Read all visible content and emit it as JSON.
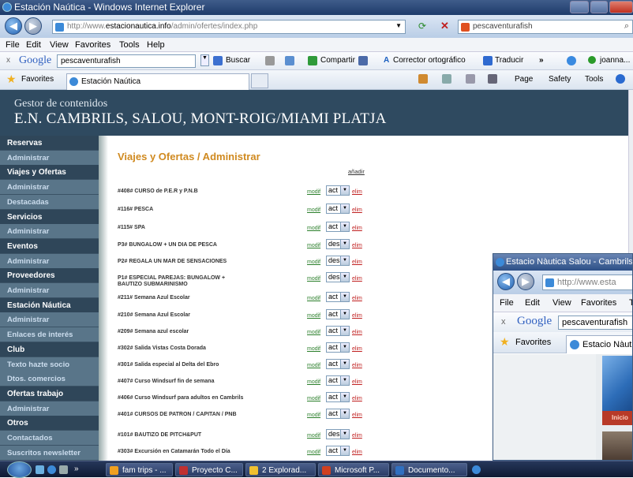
{
  "browser": {
    "title": "Estación Naútica - Windows Internet Explorer",
    "url_prefix": "http://www.",
    "url_domain": "estacionautica.info",
    "url_path": "/admin/ofertes/index.php",
    "search_value": "pescaventurafish",
    "menu": [
      "File",
      "Edit",
      "View",
      "Favorites",
      "Tools",
      "Help"
    ],
    "google_label": "Google",
    "google_search": "pescaventurafish",
    "toolbar": {
      "buscar": "Buscar",
      "compartir": "Compartir",
      "corrector": "Corrector ortográfico",
      "traducir": "Traducir",
      "more": "»",
      "user": "joanna..."
    },
    "favorites_label": "Favorites",
    "tab_title": "Estación Naútica",
    "cmd": {
      "page": "Page",
      "safety": "Safety",
      "tools": "Tools"
    }
  },
  "cms": {
    "header_small": "Gestor de contenidos",
    "header_big": "E.N. CAMBRILS, SALOU, MONT-ROIG/MIAMI PLATJA",
    "page_title": "Viajes y Ofertas / Administrar",
    "add_link": "añadir",
    "modif_label": "modif",
    "elim_label": "elim"
  },
  "sidebar": [
    {
      "label": "Reservas",
      "type": "head"
    },
    {
      "label": "Administrar",
      "type": "sub"
    },
    {
      "label": "Viajes y Ofertas",
      "type": "head"
    },
    {
      "label": "Administrar",
      "type": "sub"
    },
    {
      "label": "Destacadas",
      "type": "sub"
    },
    {
      "label": "Servicios",
      "type": "head"
    },
    {
      "label": "Administrar",
      "type": "sub"
    },
    {
      "label": "Eventos",
      "type": "head"
    },
    {
      "label": "Administrar",
      "type": "sub"
    },
    {
      "label": "Proveedores",
      "type": "head"
    },
    {
      "label": "Administrar",
      "type": "sub"
    },
    {
      "label": "Estación Náutica",
      "type": "head"
    },
    {
      "label": "Administrar",
      "type": "sub"
    },
    {
      "label": "Enlaces de interés",
      "type": "sub"
    },
    {
      "label": "Club",
      "type": "head"
    },
    {
      "label": "Texto hazte socio",
      "type": "sub"
    },
    {
      "label": "Dtos. comercios",
      "type": "sub"
    },
    {
      "label": "Ofertas trabajo",
      "type": "head"
    },
    {
      "label": "Administrar",
      "type": "sub"
    },
    {
      "label": "Otros",
      "type": "head"
    },
    {
      "label": "Contactados",
      "type": "sub"
    },
    {
      "label": "Suscritos newsletter",
      "type": "sub"
    }
  ],
  "offers": [
    {
      "name": "#408# CURSO de P.E.R y P.N.B",
      "status": "act"
    },
    {
      "name": "#116# PESCA",
      "status": "act"
    },
    {
      "name": "#115# SPA",
      "status": "act"
    },
    {
      "name": "P3# BUNGALOW + UN DIA DE PESCA",
      "status": "des"
    },
    {
      "name": "P2# REGALA UN MAR DE SENSACIONES",
      "status": "des"
    },
    {
      "name": "P1# ESPECIAL PAREJAS: BUNGALOW + BAUTIZO SUBMARINISMO",
      "status": "des"
    },
    {
      "name": "#211# Semana Azul Escolar",
      "status": "act"
    },
    {
      "name": "#210# Semana Azul Escolar",
      "status": "act"
    },
    {
      "name": "#209# Semana azul escolar",
      "status": "act"
    },
    {
      "name": "#302# Salida Vistas Costa Dorada",
      "status": "act"
    },
    {
      "name": "#301# Salida especial al Delta del Ebro",
      "status": "act"
    },
    {
      "name": "#407# Curso Windsurf fin de semana",
      "status": "act"
    },
    {
      "name": "#406# Curso Windsurf para adultos en Cambrils",
      "status": "act"
    },
    {
      "name": "#401# CURSOS DE PATRON / CAPITAN / PNB",
      "status": "act"
    },
    {
      "name": "#101# BAUTIZO DE PITCH&PUT",
      "status": "des"
    },
    {
      "name": "#303# Excursión en Catamarán Todo el Día",
      "status": "act"
    }
  ],
  "second_window": {
    "title": "Estacio Nàutica Salou - Cambrils",
    "url": "http://www.esta",
    "menu": [
      "File",
      "Edit",
      "View",
      "Favorites",
      "T"
    ],
    "google_search": "pescaventurafish",
    "favorites": "Favorites",
    "tab": "Estacio Nàutic",
    "inicio": "Inicio"
  },
  "taskbar": [
    {
      "label": "fam trips - ...",
      "color": "#f0a020"
    },
    {
      "label": "Proyecto C...",
      "color": "#c03030"
    },
    {
      "label": "2 Explorad...",
      "color": "#f0c030"
    },
    {
      "label": "Microsoft P...",
      "color": "#d04020"
    },
    {
      "label": "Documento...",
      "color": "#3070c0"
    }
  ]
}
